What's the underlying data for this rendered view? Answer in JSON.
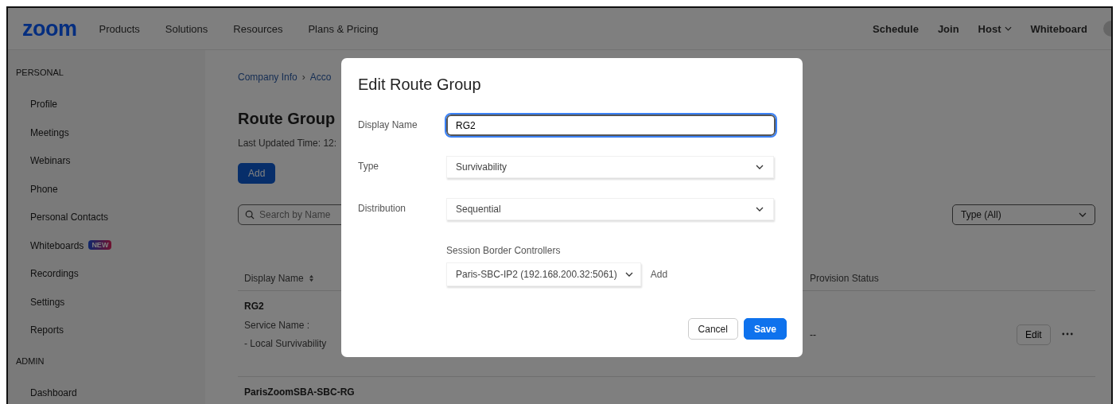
{
  "nav": {
    "logo": "zoom",
    "links": [
      "Products",
      "Solutions",
      "Resources",
      "Plans & Pricing"
    ],
    "right_links": [
      {
        "label": "Schedule",
        "dropdown": false
      },
      {
        "label": "Join",
        "dropdown": false
      },
      {
        "label": "Host",
        "dropdown": true
      },
      {
        "label": "Whiteboard",
        "dropdown": false
      }
    ]
  },
  "sidebar": {
    "sections": [
      {
        "title": "PERSONAL",
        "items": [
          {
            "label": "Profile"
          },
          {
            "label": "Meetings"
          },
          {
            "label": "Webinars"
          },
          {
            "label": "Phone"
          },
          {
            "label": "Personal Contacts"
          },
          {
            "label": "Whiteboards",
            "badge": "NEW"
          },
          {
            "label": "Recordings"
          },
          {
            "label": "Settings"
          },
          {
            "label": "Reports"
          }
        ]
      },
      {
        "title": "ADMIN",
        "items": [
          {
            "label": "Dashboard"
          }
        ]
      }
    ]
  },
  "page": {
    "breadcrumb": [
      "Company Info",
      "›",
      "Acco"
    ],
    "title": "Route Group",
    "last_updated": "Last Updated Time: 12:",
    "add_button": "Add",
    "search": {
      "placeholder": "Search by Name"
    },
    "type_filter": "Type (All)",
    "table": {
      "columns": [
        {
          "label": "Display Name",
          "sortable": true
        },
        {
          "label": "Provision Status",
          "sortable": false
        }
      ],
      "rows": [
        {
          "name": "RG2",
          "details": [
            "Service Name :",
            "- Local Survivability"
          ],
          "provision_status": "--",
          "edit": "Edit"
        },
        {
          "name": "ParisZoomSBA-SBC-RG"
        }
      ]
    }
  },
  "dialog": {
    "title": "Edit Route Group",
    "display_name": {
      "label": "Display Name",
      "value": "RG2"
    },
    "type": {
      "label": "Type",
      "value": "Survivability"
    },
    "distribution": {
      "label": "Distribution",
      "value": "Sequential"
    },
    "sbc": {
      "label": "Session Border Controllers",
      "value": "Paris-SBC-IP2 (192.168.200.32:5061)",
      "add": "Add"
    },
    "buttons": [
      {
        "label": "Cancel",
        "kind": "secondary"
      },
      {
        "label": "Save",
        "kind": "primary"
      }
    ]
  }
}
